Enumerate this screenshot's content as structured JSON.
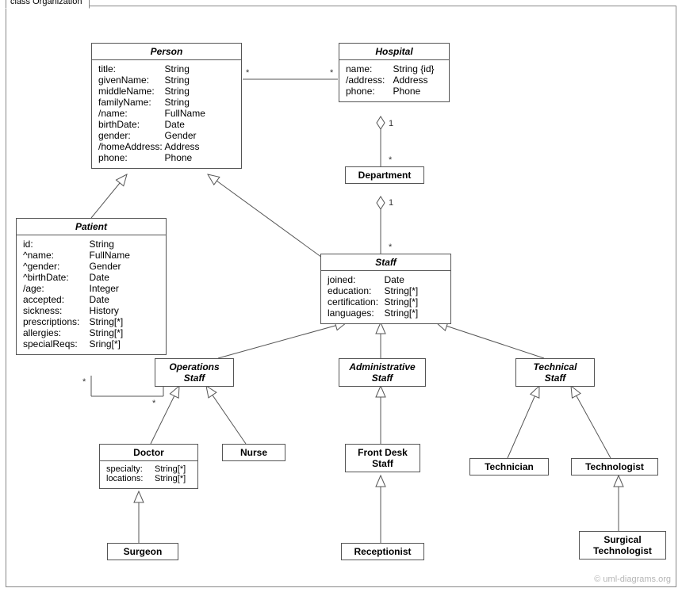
{
  "frame_title": "class Organization",
  "copyright": "© uml-diagrams.org",
  "classes": {
    "Person": {
      "name": "Person",
      "attrs": [
        [
          "title:",
          "String"
        ],
        [
          "givenName:",
          "String"
        ],
        [
          "middleName:",
          "String"
        ],
        [
          "familyName:",
          "String"
        ],
        [
          "/name:",
          "FullName"
        ],
        [
          "birthDate:",
          "Date"
        ],
        [
          "gender:",
          "Gender"
        ],
        [
          "/homeAddress:",
          "Address"
        ],
        [
          "phone:",
          "Phone"
        ]
      ]
    },
    "Hospital": {
      "name": "Hospital",
      "attrs": [
        [
          "name:",
          "String {id}"
        ],
        [
          "/address:",
          "Address"
        ],
        [
          "phone:",
          "Phone"
        ]
      ]
    },
    "Department": {
      "name": "Department"
    },
    "Patient": {
      "name": "Patient",
      "attrs": [
        [
          "id:",
          "String"
        ],
        [
          "^name:",
          "FullName"
        ],
        [
          "^gender:",
          "Gender"
        ],
        [
          "^birthDate:",
          "Date"
        ],
        [
          "/age:",
          "Integer"
        ],
        [
          "accepted:",
          "Date"
        ],
        [
          "sickness:",
          "History"
        ],
        [
          "prescriptions:",
          "String[*]"
        ],
        [
          "allergies:",
          "String[*]"
        ],
        [
          "specialReqs:",
          "Sring[*]"
        ]
      ]
    },
    "Staff": {
      "name": "Staff",
      "attrs": [
        [
          "joined:",
          "Date"
        ],
        [
          "education:",
          "String[*]"
        ],
        [
          "certification:",
          "String[*]"
        ],
        [
          "languages:",
          "String[*]"
        ]
      ]
    },
    "OperationsStaff": {
      "name": "Operations",
      "name2": "Staff"
    },
    "AdministrativeStaff": {
      "name": "Administrative",
      "name2": "Staff"
    },
    "TechnicalStaff": {
      "name": "Technical",
      "name2": "Staff"
    },
    "Doctor": {
      "name": "Doctor",
      "attrs": [
        [
          "specialty:",
          "String[*]"
        ],
        [
          "locations:",
          "String[*]"
        ]
      ]
    },
    "Nurse": {
      "name": "Nurse"
    },
    "FrontDeskStaff": {
      "name": "Front Desk",
      "name2": "Staff"
    },
    "Technician": {
      "name": "Technician"
    },
    "Technologist": {
      "name": "Technologist"
    },
    "Surgeon": {
      "name": "Surgeon"
    },
    "Receptionist": {
      "name": "Receptionist"
    },
    "SurgicalTechnologist": {
      "name": "Surgical",
      "name2": "Technologist"
    }
  },
  "mults": {
    "ph_l": "*",
    "ph_r": "*",
    "hd_top": "1",
    "hd_bot": "*",
    "ds_top": "1",
    "ds_bot": "*",
    "po_l": "*",
    "po_r": "*"
  }
}
